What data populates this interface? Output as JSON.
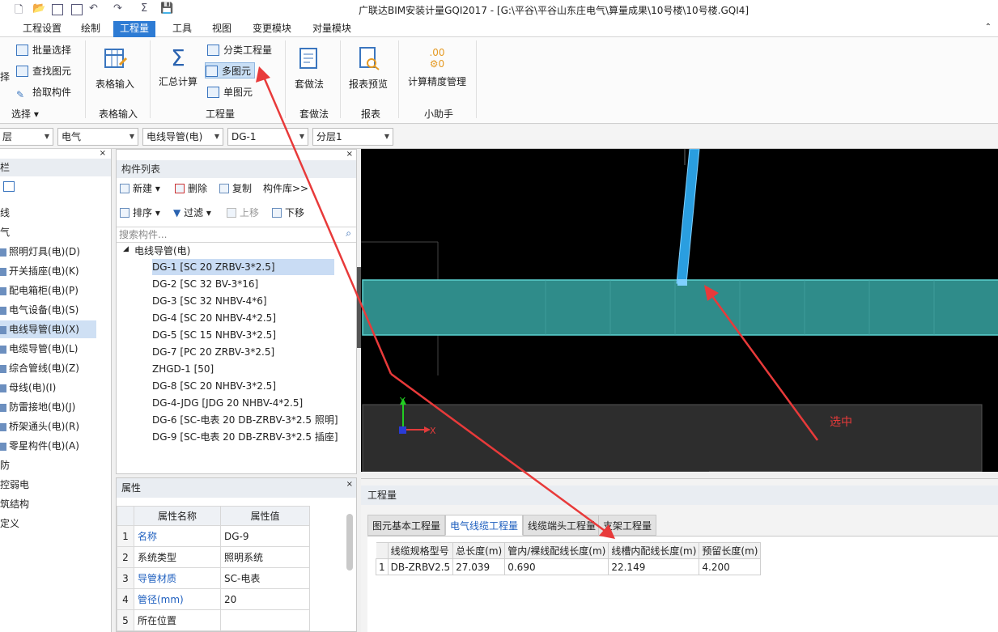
{
  "window": {
    "title": "广联达BIM安装计量GQI2017 - [G:\\平谷\\平谷山东庄电气\\算量成果\\10号楼\\10号楼.GQI4]"
  },
  "menu": [
    "工程设置",
    "绘制",
    "工程量",
    "工具",
    "视图",
    "变更模块",
    "对量模块"
  ],
  "menu_active": "工程量",
  "ribbon": {
    "select_group": {
      "batch_select": "批量选择",
      "find_element": "查找图元",
      "pick_component": "拾取构件",
      "label": "选择",
      "cut": "择"
    },
    "table_input": {
      "button": "表格输入",
      "label": "表格输入"
    },
    "quantity": {
      "summary_calc": "汇总计算",
      "category_qty": "分类工程量",
      "multi_element": "多图元",
      "single_element": "单图元",
      "label": "工程量"
    },
    "set_method": {
      "button": "套做法",
      "label": "套做法"
    },
    "report": {
      "button": "报表预览",
      "label": "报表"
    },
    "helper": {
      "button": "计算精度管理",
      "label": "小助手"
    }
  },
  "dropdowns": [
    "层",
    "电气",
    "电线导管(电)",
    "DG-1",
    "分层1"
  ],
  "leftnav": {
    "header": "栏",
    "items": [
      "线",
      "气",
      "照明灯具(电)(D)",
      "开关插座(电)(K)",
      "配电箱柜(电)(P)",
      "电气设备(电)(S)",
      "电线导管(电)(X)",
      "电缆导管(电)(L)",
      "综合管线(电)(Z)",
      "母线(电)(I)",
      "防雷接地(电)(J)",
      "桥架通头(电)(R)",
      "零星构件(电)(A)",
      "防",
      "控弱电",
      "筑结构",
      "定义"
    ],
    "selected_index": 6
  },
  "component_list": {
    "title": "构件列表",
    "toolbar": {
      "new": "新建",
      "delete": "删除",
      "copy": "复制",
      "library": "构件库>>",
      "sort": "排序",
      "filter": "过滤",
      "up": "上移",
      "down": "下移"
    },
    "search_placeholder": "搜索构件...",
    "root": "电线导管(电)",
    "items": [
      "DG-1 [SC 20 ZRBV-3*2.5]",
      "DG-2 [SC 32 BV-3*16]",
      "DG-3 [SC 32 NHBV-4*6]",
      "DG-4 [SC 20 NHBV-4*2.5]",
      "DG-5 [SC 15 NHBV-3*2.5]",
      "DG-7 [PC 20 ZRBV-3*2.5]",
      "ZHGD-1 [50]",
      "DG-8 [SC 20 NHBV-3*2.5]",
      "DG-4-JDG [JDG 20 NHBV-4*2.5]",
      "DG-6 [SC-电表 20 DB-ZRBV-3*2.5 照明]",
      "DG-9 [SC-电表 20 DB-ZRBV-3*2.5 插座]"
    ],
    "selected_index": 0
  },
  "properties": {
    "title": "属性",
    "col_name": "属性名称",
    "col_value": "属性值",
    "rows": [
      {
        "n": "1",
        "name": "名称",
        "value": "DG-9",
        "blue": true
      },
      {
        "n": "2",
        "name": "系统类型",
        "value": "照明系统",
        "blue": false
      },
      {
        "n": "3",
        "name": "导管材质",
        "value": "SC-电表",
        "blue": true
      },
      {
        "n": "4",
        "name": "管径(mm)",
        "value": "20",
        "blue": true
      },
      {
        "n": "5",
        "name": "所在位置",
        "value": "",
        "blue": false
      }
    ]
  },
  "quantity_panel": {
    "title": "工程量",
    "tabs": [
      "图元基本工程量",
      "电气线缆工程量",
      "线缆端头工程量",
      "支架工程量"
    ],
    "active_tab": 1,
    "columns": [
      "线缆规格型号",
      "总长度(m)",
      "管内/裸线配线长度(m)",
      "线槽内配线长度(m)",
      "预留长度(m)"
    ],
    "rows": [
      [
        "DB-ZRBV2.5",
        "27.039",
        "0.690",
        "22.149",
        "4.200"
      ]
    ],
    "row_numbers": [
      "1"
    ]
  },
  "annotation": {
    "label": "选中",
    "color": "#e83a3a"
  },
  "axis": {
    "x": "X",
    "y": "Y"
  }
}
